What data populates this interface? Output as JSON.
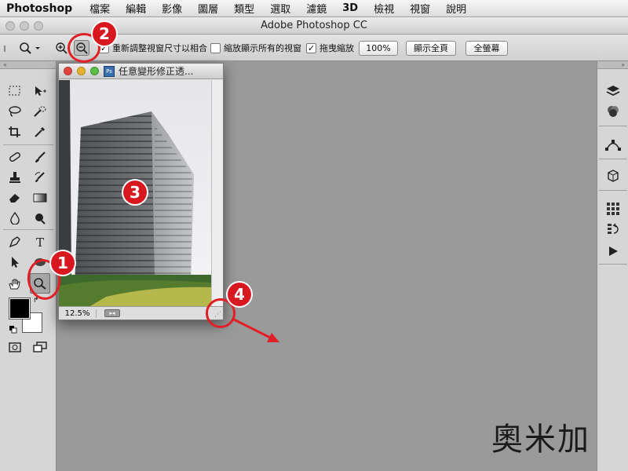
{
  "menubar": {
    "app_name": "Photoshop",
    "items": [
      "檔案",
      "編輯",
      "影像",
      "圖層",
      "類型",
      "選取",
      "濾鏡",
      "3D",
      "檢視",
      "視窗",
      "說明"
    ]
  },
  "window": {
    "title": "Adobe Photoshop CC"
  },
  "options_bar": {
    "resize_windows_label": "重新調整視窗尺寸以相合",
    "resize_windows_checked": true,
    "zoom_all_windows_label": "縮放顯示所有的視窗",
    "zoom_all_windows_checked": false,
    "scrubby_zoom_label": "拖曳縮放",
    "scrubby_zoom_checked": true,
    "actual_pixels_label": "100%",
    "fit_screen_label": "顯示全頁",
    "fill_screen_label": "全螢幕"
  },
  "document": {
    "title": "任意變形修正透...",
    "zoom": "12.5%"
  },
  "annotations": {
    "one": "1",
    "two": "2",
    "three": "3",
    "four": "4"
  },
  "watermark": {
    "text": "奧米加"
  },
  "colors": {
    "annotation_red": "#e01f26",
    "workspace_gray": "#9a9a9a"
  }
}
